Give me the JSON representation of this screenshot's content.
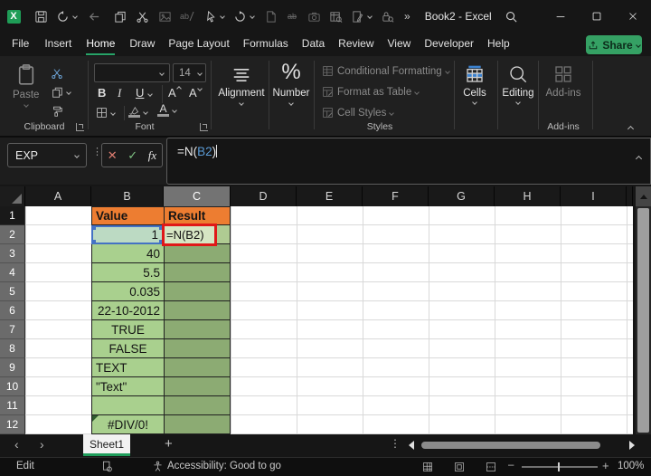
{
  "window": {
    "title": "Book2 - Excel"
  },
  "qat": {
    "overflow": "»",
    "replace_glyph": "ab",
    "strike_glyph": "ab"
  },
  "menu": {
    "tabs": [
      "File",
      "Insert",
      "Home",
      "Draw",
      "Page Layout",
      "Formulas",
      "Data",
      "Review",
      "View",
      "Developer",
      "Help"
    ],
    "active_tab": "Home",
    "share": "Share"
  },
  "ribbon": {
    "paste": "Paste",
    "clipboard_group": "Clipboard",
    "font_group": "Font",
    "font_size": "14",
    "bold": "B",
    "italic": "I",
    "underline": "U",
    "grow_font": "A",
    "shrink_font": "A",
    "font_color": "A",
    "alignment": "Alignment",
    "number_icon": "%",
    "number": "Number",
    "styles_items": [
      "Conditional Formatting",
      "Format as Table",
      "Cell Styles"
    ],
    "styles_group": "Styles",
    "cells": "Cells",
    "editing": "Editing",
    "addins": "Add-ins",
    "addins_group": "Add-ins"
  },
  "formula_bar": {
    "name_box": "EXP",
    "fx": "fx",
    "formula_pre": "=N(",
    "formula_ref": "B2",
    "formula_post": ")"
  },
  "grid": {
    "columns": [
      "A",
      "B",
      "C",
      "D",
      "E",
      "F",
      "G",
      "H",
      "I"
    ],
    "rows": [
      "1",
      "2",
      "3",
      "4",
      "5",
      "6",
      "7",
      "8",
      "9",
      "10",
      "11",
      "12"
    ],
    "value_header": "Value",
    "result_header": "Result",
    "b_values": [
      "1",
      "40",
      "5.5",
      "0.035",
      "22-10-2012",
      "TRUE",
      "FALSE",
      "TEXT",
      "\"Text\"",
      "",
      "#DIV/0!"
    ],
    "c2_formula": "=N(B2)",
    "colors": {
      "header_fill": "#ED7D31",
      "value_fill": "#A9D08E",
      "result_fill": "#8CAB73",
      "active_ref_fill": "#BCDAC3",
      "ref_border": "#4472C4",
      "edit_border": "#E01818",
      "edit_fill": "#D6E5C3"
    }
  },
  "sheets": {
    "tab": "Sheet1"
  },
  "status": {
    "mode": "Edit",
    "accessibility": "Accessibility: Good to go",
    "zoom": "100%"
  }
}
